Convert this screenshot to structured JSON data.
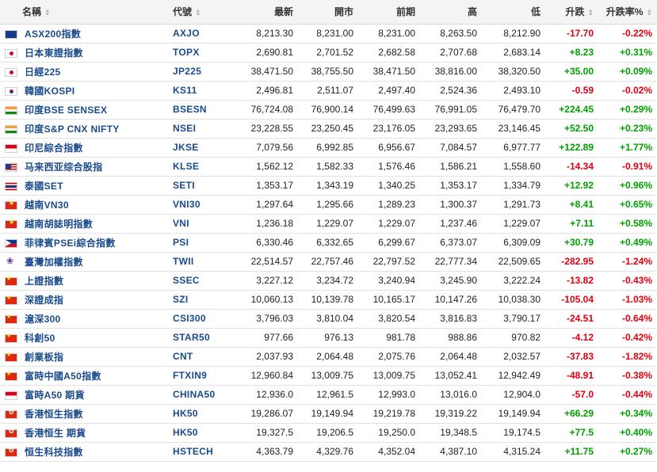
{
  "headers": {
    "name": "名稱",
    "code": "代號",
    "last": "最新",
    "open": "開市",
    "prev": "前期",
    "high": "高",
    "low": "低",
    "change": "升跌",
    "change_pct": "升跌率%"
  },
  "sort_icon": "⇕",
  "rows": [
    {
      "flag": "au",
      "name": "ASX200指數",
      "code": "AXJO",
      "last": "8,213.30",
      "open": "8,231.00",
      "prev": "8,231.00",
      "high": "8,263.50",
      "low": "8,212.90",
      "chg": "-17.70",
      "pct": "-0.22%",
      "dir": "neg"
    },
    {
      "flag": "jp",
      "name": "日本東證指數",
      "code": "TOPX",
      "last": "2,690.81",
      "open": "2,701.52",
      "prev": "2,682.58",
      "high": "2,707.68",
      "low": "2,683.14",
      "chg": "+8.23",
      "pct": "+0.31%",
      "dir": "pos"
    },
    {
      "flag": "jp",
      "name": "日經225",
      "code": "JP225",
      "last": "38,471.50",
      "open": "38,755.50",
      "prev": "38,471.50",
      "high": "38,816.00",
      "low": "38,320.50",
      "chg": "+35.00",
      "pct": "+0.09%",
      "dir": "pos"
    },
    {
      "flag": "kr",
      "name": "韓國KOSPI",
      "code": "KS11",
      "last": "2,496.81",
      "open": "2,511.07",
      "prev": "2,497.40",
      "high": "2,524.36",
      "low": "2,493.10",
      "chg": "-0.59",
      "pct": "-0.02%",
      "dir": "neg"
    },
    {
      "flag": "in",
      "name": "印度BSE SENSEX",
      "code": "BSESN",
      "last": "76,724.08",
      "open": "76,900.14",
      "prev": "76,499.63",
      "high": "76,991.05",
      "low": "76,479.70",
      "chg": "+224.45",
      "pct": "+0.29%",
      "dir": "pos"
    },
    {
      "flag": "in",
      "name": "印度S&P CNX NIFTY",
      "code": "NSEI",
      "last": "23,228.55",
      "open": "23,250.45",
      "prev": "23,176.05",
      "high": "23,293.65",
      "low": "23,146.45",
      "chg": "+52.50",
      "pct": "+0.23%",
      "dir": "pos"
    },
    {
      "flag": "id",
      "name": "印尼綜合指數",
      "code": "JKSE",
      "last": "7,079.56",
      "open": "6,992.85",
      "prev": "6,956.67",
      "high": "7,084.57",
      "low": "6,977.77",
      "chg": "+122.89",
      "pct": "+1.77%",
      "dir": "pos"
    },
    {
      "flag": "my",
      "name": "马来西亚综合股指",
      "code": "KLSE",
      "last": "1,562.12",
      "open": "1,582.33",
      "prev": "1,576.46",
      "high": "1,586.21",
      "low": "1,558.60",
      "chg": "-14.34",
      "pct": "-0.91%",
      "dir": "neg"
    },
    {
      "flag": "th",
      "name": "泰國SET",
      "code": "SETI",
      "last": "1,353.17",
      "open": "1,343.19",
      "prev": "1,340.25",
      "high": "1,353.17",
      "low": "1,334.79",
      "chg": "+12.92",
      "pct": "+0.96%",
      "dir": "pos"
    },
    {
      "flag": "vn",
      "name": "越南VN30",
      "code": "VNI30",
      "last": "1,297.64",
      "open": "1,295.66",
      "prev": "1,289.23",
      "high": "1,300.37",
      "low": "1,291.73",
      "chg": "+8.41",
      "pct": "+0.65%",
      "dir": "pos"
    },
    {
      "flag": "vn",
      "name": "越南胡誌明指數",
      "code": "VNI",
      "last": "1,236.18",
      "open": "1,229.07",
      "prev": "1,229.07",
      "high": "1,237.46",
      "low": "1,229.07",
      "chg": "+7.11",
      "pct": "+0.58%",
      "dir": "pos"
    },
    {
      "flag": "ph",
      "name": "菲律賓PSEi綜合指數",
      "code": "PSI",
      "last": "6,330.46",
      "open": "6,332.65",
      "prev": "6,299.67",
      "high": "6,373.07",
      "low": "6,309.09",
      "chg": "+30.79",
      "pct": "+0.49%",
      "dir": "pos"
    },
    {
      "flag": "tw",
      "name": "臺灣加權指數",
      "code": "TWII",
      "last": "22,514.57",
      "open": "22,757.46",
      "prev": "22,797.52",
      "high": "22,777.34",
      "low": "22,509.65",
      "chg": "-282.95",
      "pct": "-1.24%",
      "dir": "neg"
    },
    {
      "flag": "cn",
      "name": "上證指數",
      "code": "SSEC",
      "last": "3,227.12",
      "open": "3,234.72",
      "prev": "3,240.94",
      "high": "3,245.90",
      "low": "3,222.24",
      "chg": "-13.82",
      "pct": "-0.43%",
      "dir": "neg"
    },
    {
      "flag": "cn",
      "name": "深證成指",
      "code": "SZI",
      "last": "10,060.13",
      "open": "10,139.78",
      "prev": "10,165.17",
      "high": "10,147.26",
      "low": "10,038.30",
      "chg": "-105.04",
      "pct": "-1.03%",
      "dir": "neg"
    },
    {
      "flag": "cn",
      "name": "滬深300",
      "code": "CSI300",
      "last": "3,796.03",
      "open": "3,810.04",
      "prev": "3,820.54",
      "high": "3,816.83",
      "low": "3,790.17",
      "chg": "-24.51",
      "pct": "-0.64%",
      "dir": "neg"
    },
    {
      "flag": "cn",
      "name": "科創50",
      "code": "STAR50",
      "last": "977.66",
      "open": "976.13",
      "prev": "981.78",
      "high": "988.86",
      "low": "970.82",
      "chg": "-4.12",
      "pct": "-0.42%",
      "dir": "neg"
    },
    {
      "flag": "cn",
      "name": "創業板指",
      "code": "CNT",
      "last": "2,037.93",
      "open": "2,064.48",
      "prev": "2,075.76",
      "high": "2,064.48",
      "low": "2,032.57",
      "chg": "-37.83",
      "pct": "-1.82%",
      "dir": "neg"
    },
    {
      "flag": "cn",
      "name": "富時中國A50指數",
      "code": "FTXIN9",
      "last": "12,960.84",
      "open": "13,009.75",
      "prev": "13,009.75",
      "high": "13,052.41",
      "low": "12,942.49",
      "chg": "-48.91",
      "pct": "-0.38%",
      "dir": "neg"
    },
    {
      "flag": "sg",
      "name": "富時A50 期貨",
      "code": "CHINA50",
      "last": "12,936.0",
      "open": "12,961.5",
      "prev": "12,993.0",
      "high": "13,016.0",
      "low": "12,904.0",
      "chg": "-57.0",
      "pct": "-0.44%",
      "dir": "neg"
    },
    {
      "flag": "hk",
      "name": "香港恒生指數",
      "code": "HK50",
      "last": "19,286.07",
      "open": "19,149.94",
      "prev": "19,219.78",
      "high": "19,319.22",
      "low": "19,149.94",
      "chg": "+66.29",
      "pct": "+0.34%",
      "dir": "pos"
    },
    {
      "flag": "hk",
      "name": "香港恒生 期貨",
      "code": "HK50",
      "last": "19,327.5",
      "open": "19,206.5",
      "prev": "19,250.0",
      "high": "19,348.5",
      "low": "19,174.5",
      "chg": "+77.5",
      "pct": "+0.40%",
      "dir": "pos"
    },
    {
      "flag": "hk",
      "name": "恒生科技指數",
      "code": "HSTECH",
      "last": "4,363.79",
      "open": "4,329.76",
      "prev": "4,352.04",
      "high": "4,387.10",
      "low": "4,315.24",
      "chg": "+11.75",
      "pct": "+0.27%",
      "dir": "pos"
    }
  ]
}
